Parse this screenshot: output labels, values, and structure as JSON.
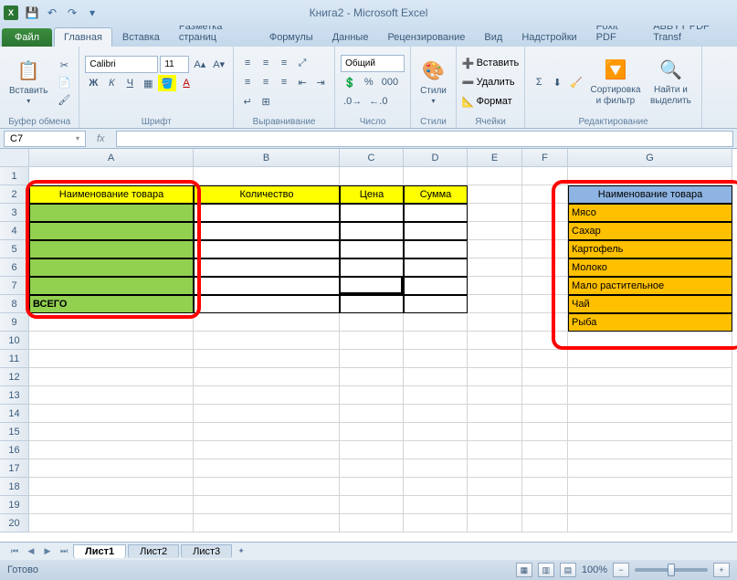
{
  "title": "Книга2 - Microsoft Excel",
  "tabs": {
    "file": "Файл",
    "items": [
      "Главная",
      "Вставка",
      "Разметка страниц",
      "Формулы",
      "Данные",
      "Рецензирование",
      "Вид",
      "Надстройки",
      "Foxit PDF",
      "ABBYY PDF Transf"
    ],
    "active": 0
  },
  "ribbon": {
    "clipboard": {
      "label": "Буфер обмена",
      "paste": "Вставить"
    },
    "font": {
      "label": "Шрифт",
      "name": "Calibri",
      "size": "11",
      "buttons": {
        "bold": "Ж",
        "italic": "К",
        "underline": "Ч"
      }
    },
    "alignment": {
      "label": "Выравнивание"
    },
    "number": {
      "label": "Число",
      "format": "Общий"
    },
    "styles": {
      "label": "Стили",
      "btn": "Стили"
    },
    "cells": {
      "label": "Ячейки",
      "insert": "Вставить",
      "delete": "Удалить",
      "format": "Формат"
    },
    "editing": {
      "label": "Редактирование",
      "sort": "Сортировка и фильтр",
      "find": "Найти и выделить"
    }
  },
  "name_box": "C7",
  "columns": [
    {
      "letter": "A",
      "width": 180
    },
    {
      "letter": "B",
      "width": 160
    },
    {
      "letter": "C",
      "width": 70
    },
    {
      "letter": "D",
      "width": 70
    },
    {
      "letter": "E",
      "width": 60
    },
    {
      "letter": "F",
      "width": 50
    },
    {
      "letter": "G",
      "width": 180
    }
  ],
  "rows": [
    1,
    2,
    3,
    4,
    5,
    6,
    7,
    8,
    9,
    10,
    11,
    12,
    13,
    14,
    15,
    16,
    17,
    18,
    19,
    20
  ],
  "table1": {
    "headers": [
      "Наименование товара",
      "Количество",
      "Цена",
      "Сумма"
    ],
    "total_label": "ВСЕГО"
  },
  "table2": {
    "header": "Наименование товара",
    "items": [
      "Мясо",
      "Сахар",
      "Картофель",
      "Молоко",
      "Мало растительное",
      "Чай",
      "Рыба"
    ]
  },
  "sheets": [
    "Лист1",
    "Лист2",
    "Лист3"
  ],
  "active_sheet": 0,
  "status": "Готово",
  "zoom": "100%"
}
